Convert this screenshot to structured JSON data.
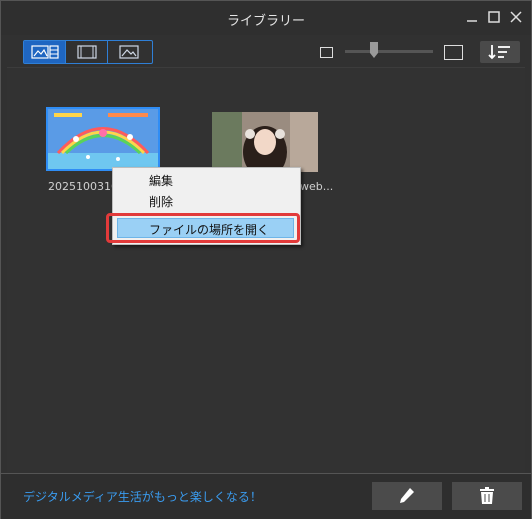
{
  "window": {
    "title": "ライブラリー"
  },
  "toolbar": {
    "views": [
      "grid-thumbnail-icon",
      "film-icon",
      "image-icon"
    ],
    "active_view": 0
  },
  "items": [
    {
      "caption": "20251003164",
      "icon": "game-thumbnail"
    },
    {
      "caption": "web...",
      "icon": "portrait-thumbnail"
    }
  ],
  "context_menu": {
    "items": [
      "編集",
      "削除",
      "ファイルの場所を開く"
    ],
    "highlighted": 2
  },
  "footer": {
    "promo": "デジタルメディア生活がもっと楽しくなる！"
  }
}
